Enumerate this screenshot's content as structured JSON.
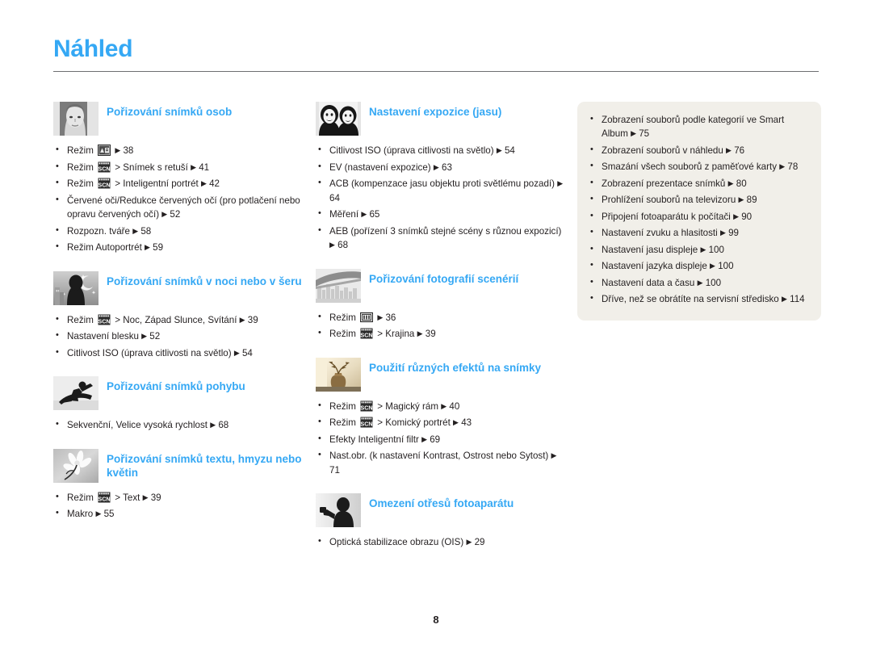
{
  "header": {
    "title": "Náhled",
    "page_number": "8"
  },
  "icons": {
    "smart_auto": "smart-auto-mode-icon",
    "scene": "scene-scn-mode-icon",
    "program": "program-mode-icon",
    "arrow": "▶"
  },
  "columns": {
    "left": [
      {
        "icon": "portrait-photo-icon",
        "title": "Pořizování snímků osob",
        "items": [
          {
            "parts": [
              {
                "t": "text",
                "v": "Režim "
              },
              {
                "t": "icon",
                "v": "smart_auto"
              },
              {
                "t": "text",
                "v": " "
              },
              {
                "t": "arrow"
              },
              {
                "t": "text",
                "v": " 38"
              }
            ]
          },
          {
            "parts": [
              {
                "t": "text",
                "v": "Režim "
              },
              {
                "t": "icon",
                "v": "scene"
              },
              {
                "t": "text",
                "v": " > Snímek s retuší "
              },
              {
                "t": "arrow"
              },
              {
                "t": "text",
                "v": " 41"
              }
            ]
          },
          {
            "parts": [
              {
                "t": "text",
                "v": "Režim "
              },
              {
                "t": "icon",
                "v": "scene"
              },
              {
                "t": "text",
                "v": " > Inteligentní portrét "
              },
              {
                "t": "arrow"
              },
              {
                "t": "text",
                "v": " 42"
              }
            ]
          },
          {
            "parts": [
              {
                "t": "text",
                "v": "Červené oči/Redukce červených očí (pro potlačení nebo opravu červených očí) "
              },
              {
                "t": "arrow"
              },
              {
                "t": "text",
                "v": " 52"
              }
            ]
          },
          {
            "parts": [
              {
                "t": "text",
                "v": "Rozpozn. tváře "
              },
              {
                "t": "arrow"
              },
              {
                "t": "text",
                "v": " 58"
              }
            ]
          },
          {
            "parts": [
              {
                "t": "text",
                "v": "Režim Autoportrét "
              },
              {
                "t": "arrow"
              },
              {
                "t": "text",
                "v": " 59"
              }
            ]
          }
        ]
      },
      {
        "icon": "night-scene-icon",
        "title": "Pořizování snímků v noci nebo v šeru",
        "items": [
          {
            "parts": [
              {
                "t": "text",
                "v": "Režim "
              },
              {
                "t": "icon",
                "v": "scene"
              },
              {
                "t": "text",
                "v": " > Noc, Západ Slunce, Svítání "
              },
              {
                "t": "arrow"
              },
              {
                "t": "text",
                "v": " 39"
              }
            ]
          },
          {
            "parts": [
              {
                "t": "text",
                "v": "Nastavení blesku "
              },
              {
                "t": "arrow"
              },
              {
                "t": "text",
                "v": " 52"
              }
            ]
          },
          {
            "parts": [
              {
                "t": "text",
                "v": "Citlivost ISO (úprava citlivosti na světlo) "
              },
              {
                "t": "arrow"
              },
              {
                "t": "text",
                "v": " 54"
              }
            ]
          }
        ]
      },
      {
        "icon": "snowboarder-motion-icon",
        "title": "Pořizování snímků pohybu",
        "items": [
          {
            "parts": [
              {
                "t": "text",
                "v": "Sekvenční, Velice vysoká rychlost "
              },
              {
                "t": "arrow"
              },
              {
                "t": "text",
                "v": " 68"
              }
            ]
          }
        ]
      },
      {
        "icon": "flower-macro-icon",
        "title": "Pořizování snímků textu, hmyzu nebo květin",
        "items": [
          {
            "parts": [
              {
                "t": "text",
                "v": "Režim "
              },
              {
                "t": "icon",
                "v": "scene"
              },
              {
                "t": "text",
                "v": " > Text "
              },
              {
                "t": "arrow"
              },
              {
                "t": "text",
                "v": " 39"
              }
            ]
          },
          {
            "parts": [
              {
                "t": "text",
                "v": "Makro "
              },
              {
                "t": "arrow"
              },
              {
                "t": "text",
                "v": " 55"
              }
            ]
          }
        ]
      }
    ],
    "middle": [
      {
        "icon": "two-faces-exposure-icon",
        "title": "Nastavení expozice (jasu)",
        "items": [
          {
            "parts": [
              {
                "t": "text",
                "v": "Citlivost ISO (úprava citlivosti na světlo) "
              },
              {
                "t": "arrow"
              },
              {
                "t": "text",
                "v": " 54"
              }
            ]
          },
          {
            "parts": [
              {
                "t": "text",
                "v": "EV (nastavení expozice) "
              },
              {
                "t": "arrow"
              },
              {
                "t": "text",
                "v": " 63"
              }
            ]
          },
          {
            "parts": [
              {
                "t": "text",
                "v": "ACB (kompenzace jasu objektu proti světlému pozadí) "
              },
              {
                "t": "arrow"
              },
              {
                "t": "text",
                "v": " 64"
              }
            ]
          },
          {
            "parts": [
              {
                "t": "text",
                "v": "Měření "
              },
              {
                "t": "arrow"
              },
              {
                "t": "text",
                "v": " 65"
              }
            ]
          },
          {
            "parts": [
              {
                "t": "text",
                "v": "AEB (pořízení 3 snímků stejné scény s různou expozicí) "
              },
              {
                "t": "arrow"
              },
              {
                "t": "text",
                "v": " 68"
              }
            ]
          }
        ]
      },
      {
        "icon": "bridge-landscape-icon",
        "title": "Pořizování fotografií scenérií",
        "items": [
          {
            "parts": [
              {
                "t": "text",
                "v": "Režim "
              },
              {
                "t": "icon",
                "v": "program"
              },
              {
                "t": "text",
                "v": " "
              },
              {
                "t": "arrow"
              },
              {
                "t": "text",
                "v": " 36"
              }
            ]
          },
          {
            "parts": [
              {
                "t": "text",
                "v": "Režim "
              },
              {
                "t": "icon",
                "v": "scene"
              },
              {
                "t": "text",
                "v": " > Krajina "
              },
              {
                "t": "arrow"
              },
              {
                "t": "text",
                "v": " 39"
              }
            ]
          }
        ]
      },
      {
        "icon": "sepia-vase-effects-icon",
        "title": "Použití různých efektů na snímky",
        "items": [
          {
            "parts": [
              {
                "t": "text",
                "v": "Režim "
              },
              {
                "t": "icon",
                "v": "scene"
              },
              {
                "t": "text",
                "v": " > Magický rám "
              },
              {
                "t": "arrow"
              },
              {
                "t": "text",
                "v": " 40"
              }
            ]
          },
          {
            "parts": [
              {
                "t": "text",
                "v": "Režim "
              },
              {
                "t": "icon",
                "v": "scene"
              },
              {
                "t": "text",
                "v": " > Komický portrét "
              },
              {
                "t": "arrow"
              },
              {
                "t": "text",
                "v": " 43"
              }
            ]
          },
          {
            "parts": [
              {
                "t": "text",
                "v": "Efekty Inteligentní filtr "
              },
              {
                "t": "arrow"
              },
              {
                "t": "text",
                "v": " 69"
              }
            ]
          },
          {
            "parts": [
              {
                "t": "text",
                "v": "Nast.obr. (k nastavení Kontrast, Ostrost nebo Sytost) "
              },
              {
                "t": "arrow"
              },
              {
                "t": "text",
                "v": " 71"
              }
            ]
          }
        ]
      },
      {
        "icon": "camera-shake-person-icon",
        "title": "Omezení otřesů fotoaparátu",
        "items": [
          {
            "parts": [
              {
                "t": "text",
                "v": "Optická stabilizace obrazu (OIS) "
              },
              {
                "t": "arrow"
              },
              {
                "t": "text",
                "v": " 29"
              }
            ]
          }
        ]
      }
    ],
    "right": {
      "background_color": "#f1efe9",
      "items": [
        {
          "parts": [
            {
              "t": "text",
              "v": "Zobrazení souborů podle kategorií ve Smart Album "
            },
            {
              "t": "arrow"
            },
            {
              "t": "text",
              "v": " 75"
            }
          ]
        },
        {
          "parts": [
            {
              "t": "text",
              "v": "Zobrazení souborů v náhledu "
            },
            {
              "t": "arrow"
            },
            {
              "t": "text",
              "v": " 76"
            }
          ]
        },
        {
          "parts": [
            {
              "t": "text",
              "v": "Smazání všech souborů z paměťové karty "
            },
            {
              "t": "arrow"
            },
            {
              "t": "text",
              "v": " 78"
            }
          ]
        },
        {
          "parts": [
            {
              "t": "text",
              "v": "Zobrazení prezentace snímků "
            },
            {
              "t": "arrow"
            },
            {
              "t": "text",
              "v": " 80"
            }
          ]
        },
        {
          "parts": [
            {
              "t": "text",
              "v": "Prohlížení souborů na televizoru "
            },
            {
              "t": "arrow"
            },
            {
              "t": "text",
              "v": " 89"
            }
          ]
        },
        {
          "parts": [
            {
              "t": "text",
              "v": "Připojení fotoaparátu k počítači "
            },
            {
              "t": "arrow"
            },
            {
              "t": "text",
              "v": " 90"
            }
          ]
        },
        {
          "parts": [
            {
              "t": "text",
              "v": "Nastavení zvuku a hlasitosti "
            },
            {
              "t": "arrow"
            },
            {
              "t": "text",
              "v": " 99"
            }
          ]
        },
        {
          "parts": [
            {
              "t": "text",
              "v": "Nastavení jasu displeje "
            },
            {
              "t": "arrow"
            },
            {
              "t": "text",
              "v": " 100"
            }
          ]
        },
        {
          "parts": [
            {
              "t": "text",
              "v": "Nastavení jazyka displeje "
            },
            {
              "t": "arrow"
            },
            {
              "t": "text",
              "v": " 100"
            }
          ]
        },
        {
          "parts": [
            {
              "t": "text",
              "v": "Nastavení data a času "
            },
            {
              "t": "arrow"
            },
            {
              "t": "text",
              "v": " 100"
            }
          ]
        },
        {
          "parts": [
            {
              "t": "text",
              "v": "Dříve, než se obrátíte na servisní středisko "
            },
            {
              "t": "arrow"
            },
            {
              "t": "text",
              "v": " 114"
            }
          ]
        }
      ]
    }
  },
  "theme": {
    "accent": "#35a8f4",
    "text": "#231f20",
    "rule": "#6d6e71",
    "icon_bg": "#e9e9e9"
  }
}
